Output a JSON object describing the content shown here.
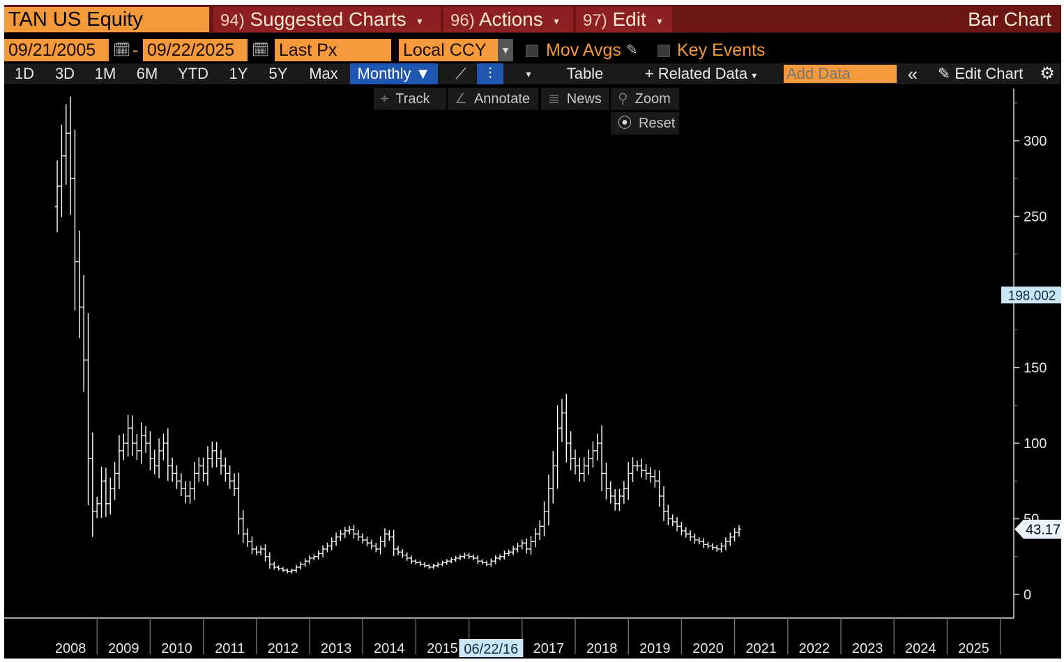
{
  "header": {
    "ticker": "TAN US Equity",
    "menus": [
      {
        "num": "94)",
        "label": "Suggested Charts"
      },
      {
        "num": "96)",
        "label": "Actions"
      },
      {
        "num": "97)",
        "label": "Edit"
      }
    ],
    "chart_mode": "Bar Chart"
  },
  "controls": {
    "start_date": "09/21/2005",
    "date_separator": "-",
    "end_date": "09/22/2025",
    "field": "Last Px",
    "currency": "Local CCY",
    "mov_avgs": "Mov Avgs",
    "key_events": "Key Events"
  },
  "range_buttons": [
    "1D",
    "3D",
    "1M",
    "6M",
    "YTD",
    "1Y",
    "5Y",
    "Max"
  ],
  "toolbar": {
    "periodicity": "Monthly",
    "table": "Table",
    "related_data": "Related Data",
    "add_data_placeholder": "Add Data",
    "edit_chart": "Edit Chart"
  },
  "chart_tools": {
    "track": "Track",
    "annotate": "Annotate",
    "news": "News",
    "zoom": "Zoom",
    "reset": "Reset"
  },
  "colors": {
    "ticker_bg": "#f59a3a",
    "menu_bg": "#8c1f1f",
    "selected_btn": "#1e56b0",
    "price_bars": "#ffffff",
    "last_price_label": "#e8f4ff",
    "crosshair_label": "#cde6f5"
  },
  "chart_data": {
    "type": "bar",
    "title": "",
    "xlabel": "",
    "ylabel": "",
    "ylim": [
      -5,
      335
    ],
    "y_ticks": [
      0,
      50,
      100,
      150,
      200,
      250,
      300
    ],
    "x_ticks": [
      "2008",
      "2009",
      "2010",
      "2011",
      "2012",
      "2013",
      "2014",
      "2015",
      "2017",
      "2018",
      "2019",
      "2020",
      "2021",
      "2022",
      "2023",
      "2024",
      "2025"
    ],
    "crosshair_date": "06/22/16",
    "crosshair_value": "198.002",
    "last_price": "43.17",
    "series": [
      {
        "start": "2008-04",
        "frequency": "monthly",
        "close": [
          270,
          290,
          305,
          275,
          220,
          190,
          155,
          90,
          55,
          60,
          75,
          60,
          70,
          80,
          95,
          100,
          110,
          100,
          95,
          105,
          100,
          90,
          85,
          95,
          100,
          85,
          80,
          75,
          70,
          65,
          70,
          80,
          85,
          80,
          90,
          95,
          90,
          85,
          80,
          75,
          70,
          50,
          40,
          35,
          30,
          28,
          30,
          25,
          20,
          18,
          17,
          16,
          15,
          16,
          18,
          20,
          22,
          24,
          25,
          27,
          30,
          32,
          35,
          38,
          40,
          42,
          43,
          40,
          38,
          36,
          34,
          32,
          30,
          35,
          40,
          38,
          30,
          28,
          26,
          24,
          22,
          21,
          20,
          19,
          18,
          19,
          20,
          21,
          22,
          23,
          24,
          25,
          26,
          25,
          24,
          22,
          21,
          20,
          22,
          24,
          25,
          27,
          28,
          30,
          32,
          34,
          30,
          35,
          40,
          45,
          55,
          70,
          85,
          110,
          120,
          100,
          90,
          85,
          80,
          85,
          90,
          95,
          100,
          80,
          70,
          65,
          60,
          65,
          70,
          80,
          85,
          85,
          82,
          80,
          78,
          75,
          65,
          55,
          50,
          48,
          45,
          42,
          40,
          38,
          36,
          35,
          33,
          32,
          31,
          30,
          32,
          35,
          38,
          41,
          43.17
        ]
      }
    ]
  }
}
